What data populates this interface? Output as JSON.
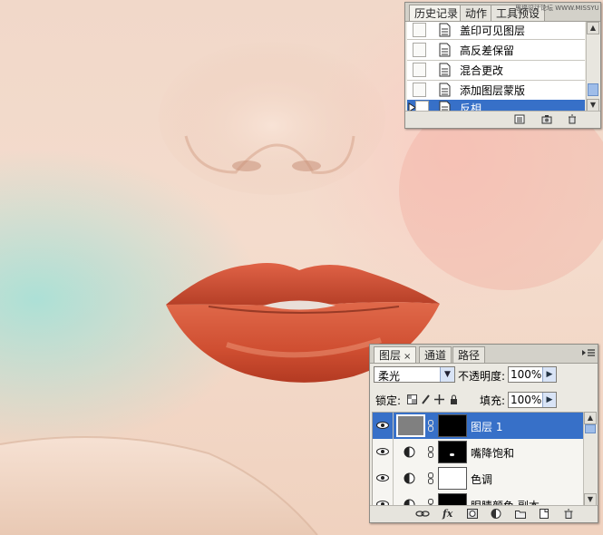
{
  "history_panel": {
    "tabs": [
      {
        "label": "历史记录"
      },
      {
        "label": "动作"
      },
      {
        "label": "工具预设"
      }
    ],
    "watermark": "思缘设计论坛 WWW.MISSYUAN.COM",
    "items": [
      {
        "label": "盖印可见图层"
      },
      {
        "label": "高反差保留"
      },
      {
        "label": "混合更改"
      },
      {
        "label": "添加图层蒙版"
      },
      {
        "label": "反相",
        "selected": true
      }
    ],
    "bottom_icons": [
      "new-document-from-state-icon",
      "camera-snapshot-icon",
      "trash-icon"
    ]
  },
  "layers_panel": {
    "tabs": [
      {
        "label": "图层",
        "close": "×"
      },
      {
        "label": "通道"
      },
      {
        "label": "路径"
      }
    ],
    "blend_mode": "柔光",
    "opacity_label": "不透明度:",
    "opacity_value": "100%",
    "lock_label": "锁定:",
    "fill_label": "填充:",
    "fill_value": "100%",
    "layers": [
      {
        "name": "图层 1",
        "selected": true,
        "thumb_color": "#808080",
        "mask_color": "#000000"
      },
      {
        "name": "嘴降饱和",
        "adjustment": true,
        "mask_color": "#000000"
      },
      {
        "name": "色调",
        "adjustment": true,
        "mask_color": "#ffffff"
      },
      {
        "name": "眼睛颜色 副本",
        "adjustment": true,
        "mask_color": "#000000"
      }
    ],
    "bottom_icons": [
      "link-layers-icon",
      "fx-icon",
      "add-mask-icon",
      "adjustment-layer-icon",
      "new-group-icon",
      "new-layer-icon",
      "trash-icon"
    ],
    "fx_label": "fx"
  },
  "colors": {
    "selection": "#3770c8",
    "panel_bg": "#ebe9e2",
    "lip": "#d8553a"
  }
}
